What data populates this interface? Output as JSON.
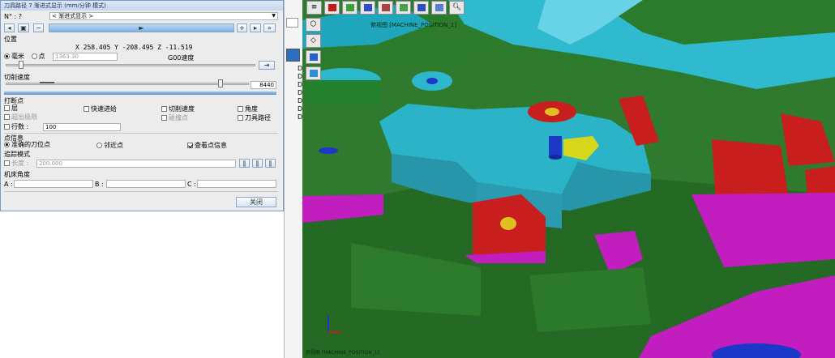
{
  "panel": {
    "title": "刀具路径 7 渐进式显示 (mm/分钟 模式)",
    "n_label": "N° : ?",
    "dropdown_value": "< 渐进式显示 >",
    "position_label": "位置",
    "coords": "X  258.405  Y  -208.495  Z  -11.519",
    "unit_mm": "毫米",
    "unit_point": "点",
    "point_value": "1363.30",
    "g00_label": "G00速度",
    "feed_label": "切削速度",
    "feed_value": "8440",
    "breakpoint_label": "打断点",
    "cb_layer": "层",
    "cb_rapid": "快速进给",
    "cb_feed": "切削速度",
    "cb_angle": "角度",
    "cb_over": "超出极限",
    "cb_collision": "碰撞点",
    "cb_toolpath": "刀具路径",
    "cb_rows": "行数 :",
    "rows_value": "100",
    "point_info_label": "点信息",
    "radio_exact": "准确的刀位点",
    "radio_near": "邻近点",
    "cb_view_info": "查看点信息",
    "trace_label": "追踪模式",
    "length_label": "长度 :",
    "length_value": "200.000",
    "machine_angle_label": "机床角度",
    "a_label": "A :",
    "b_label": "B :",
    "c_label": "C :",
    "close_label": "关闭",
    "play_icon": "►"
  },
  "viewport": {
    "label_top": "[MACHINE_POSITION_1]",
    "label_top_prefix": "俯视图",
    "label_bottom": "俯视图  [MACHINE_POSITION_1]"
  },
  "colors": {
    "model_green": "#2f7a2f",
    "cyan": "#2bb3c7",
    "red": "#c81e1e",
    "magenta": "#c21dbf",
    "tool_blue": "#1c38c9",
    "yellow": "#d7d81c"
  }
}
